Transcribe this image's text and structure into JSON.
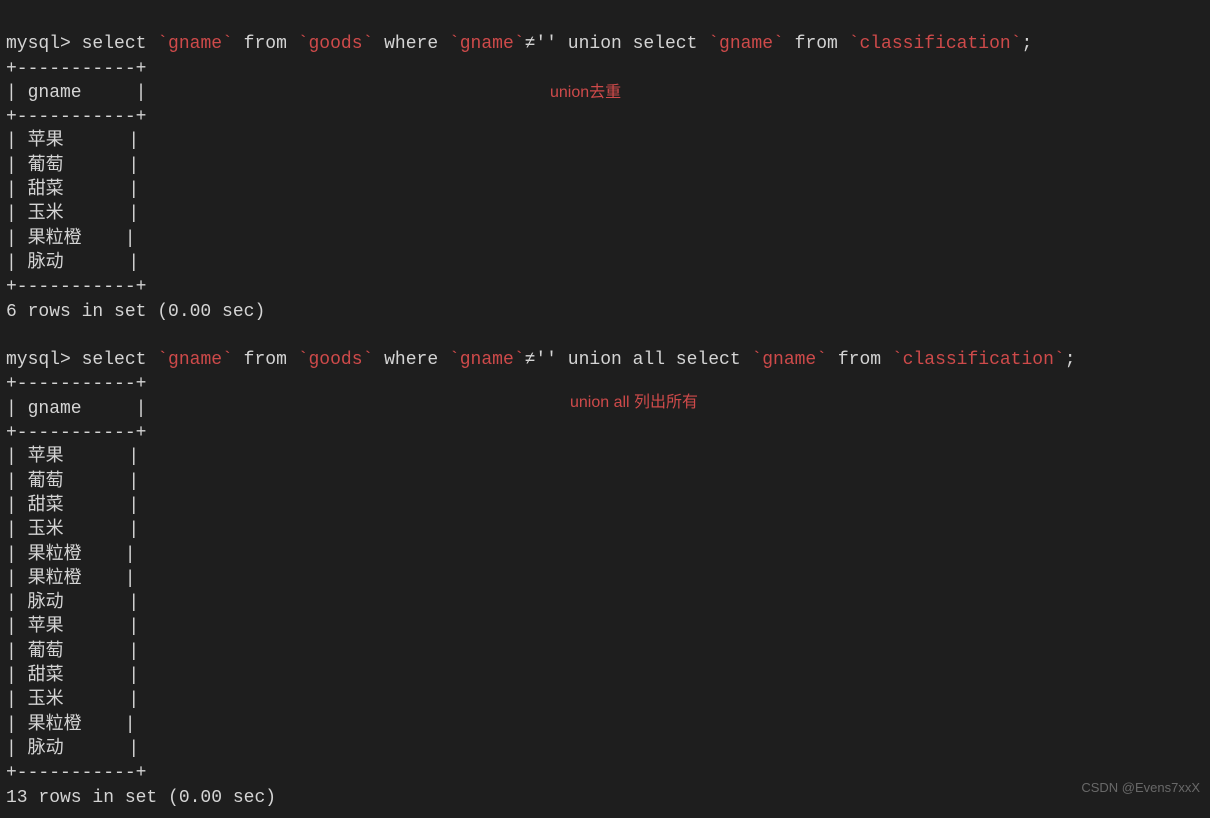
{
  "prompt": "mysql>",
  "query1": {
    "parts": [
      "select ",
      "`gname`",
      " from ",
      "`goods`",
      " where ",
      "`gname`",
      "≠",
      "''",
      " union select ",
      "`gname`",
      " from ",
      "`classification`",
      ";"
    ]
  },
  "annotation1": "union去重",
  "table1": {
    "border_top": "+-----------+",
    "header": "| gname     |",
    "border_mid": "+-----------+",
    "rows": [
      "| 苹果      |",
      "| 葡萄      |",
      "| 甜菜      |",
      "| 玉米      |",
      "| 果粒橙    |",
      "| 脉动      |"
    ],
    "border_bot": "+-----------+",
    "footer": "6 rows in set (0.00 sec)"
  },
  "query2": {
    "parts": [
      "select ",
      "`gname`",
      " from ",
      "`goods`",
      " where ",
      "`gname`",
      "≠",
      "''",
      " union all select ",
      "`gname`",
      " from ",
      "`classification`",
      ";"
    ]
  },
  "annotation2": "union all 列出所有",
  "table2": {
    "border_top": "+-----------+",
    "header": "| gname     |",
    "border_mid": "+-----------+",
    "rows": [
      "| 苹果      |",
      "| 葡萄      |",
      "| 甜菜      |",
      "| 玉米      |",
      "| 果粒橙    |",
      "| 果粒橙    |",
      "| 脉动      |",
      "| 苹果      |",
      "| 葡萄      |",
      "| 甜菜      |",
      "| 玉米      |",
      "| 果粒橙    |",
      "| 脉动      |"
    ],
    "border_bot": "+-----------+",
    "footer": "13 rows in set (0.00 sec)"
  },
  "watermark": "CSDN @Evens7xxX"
}
